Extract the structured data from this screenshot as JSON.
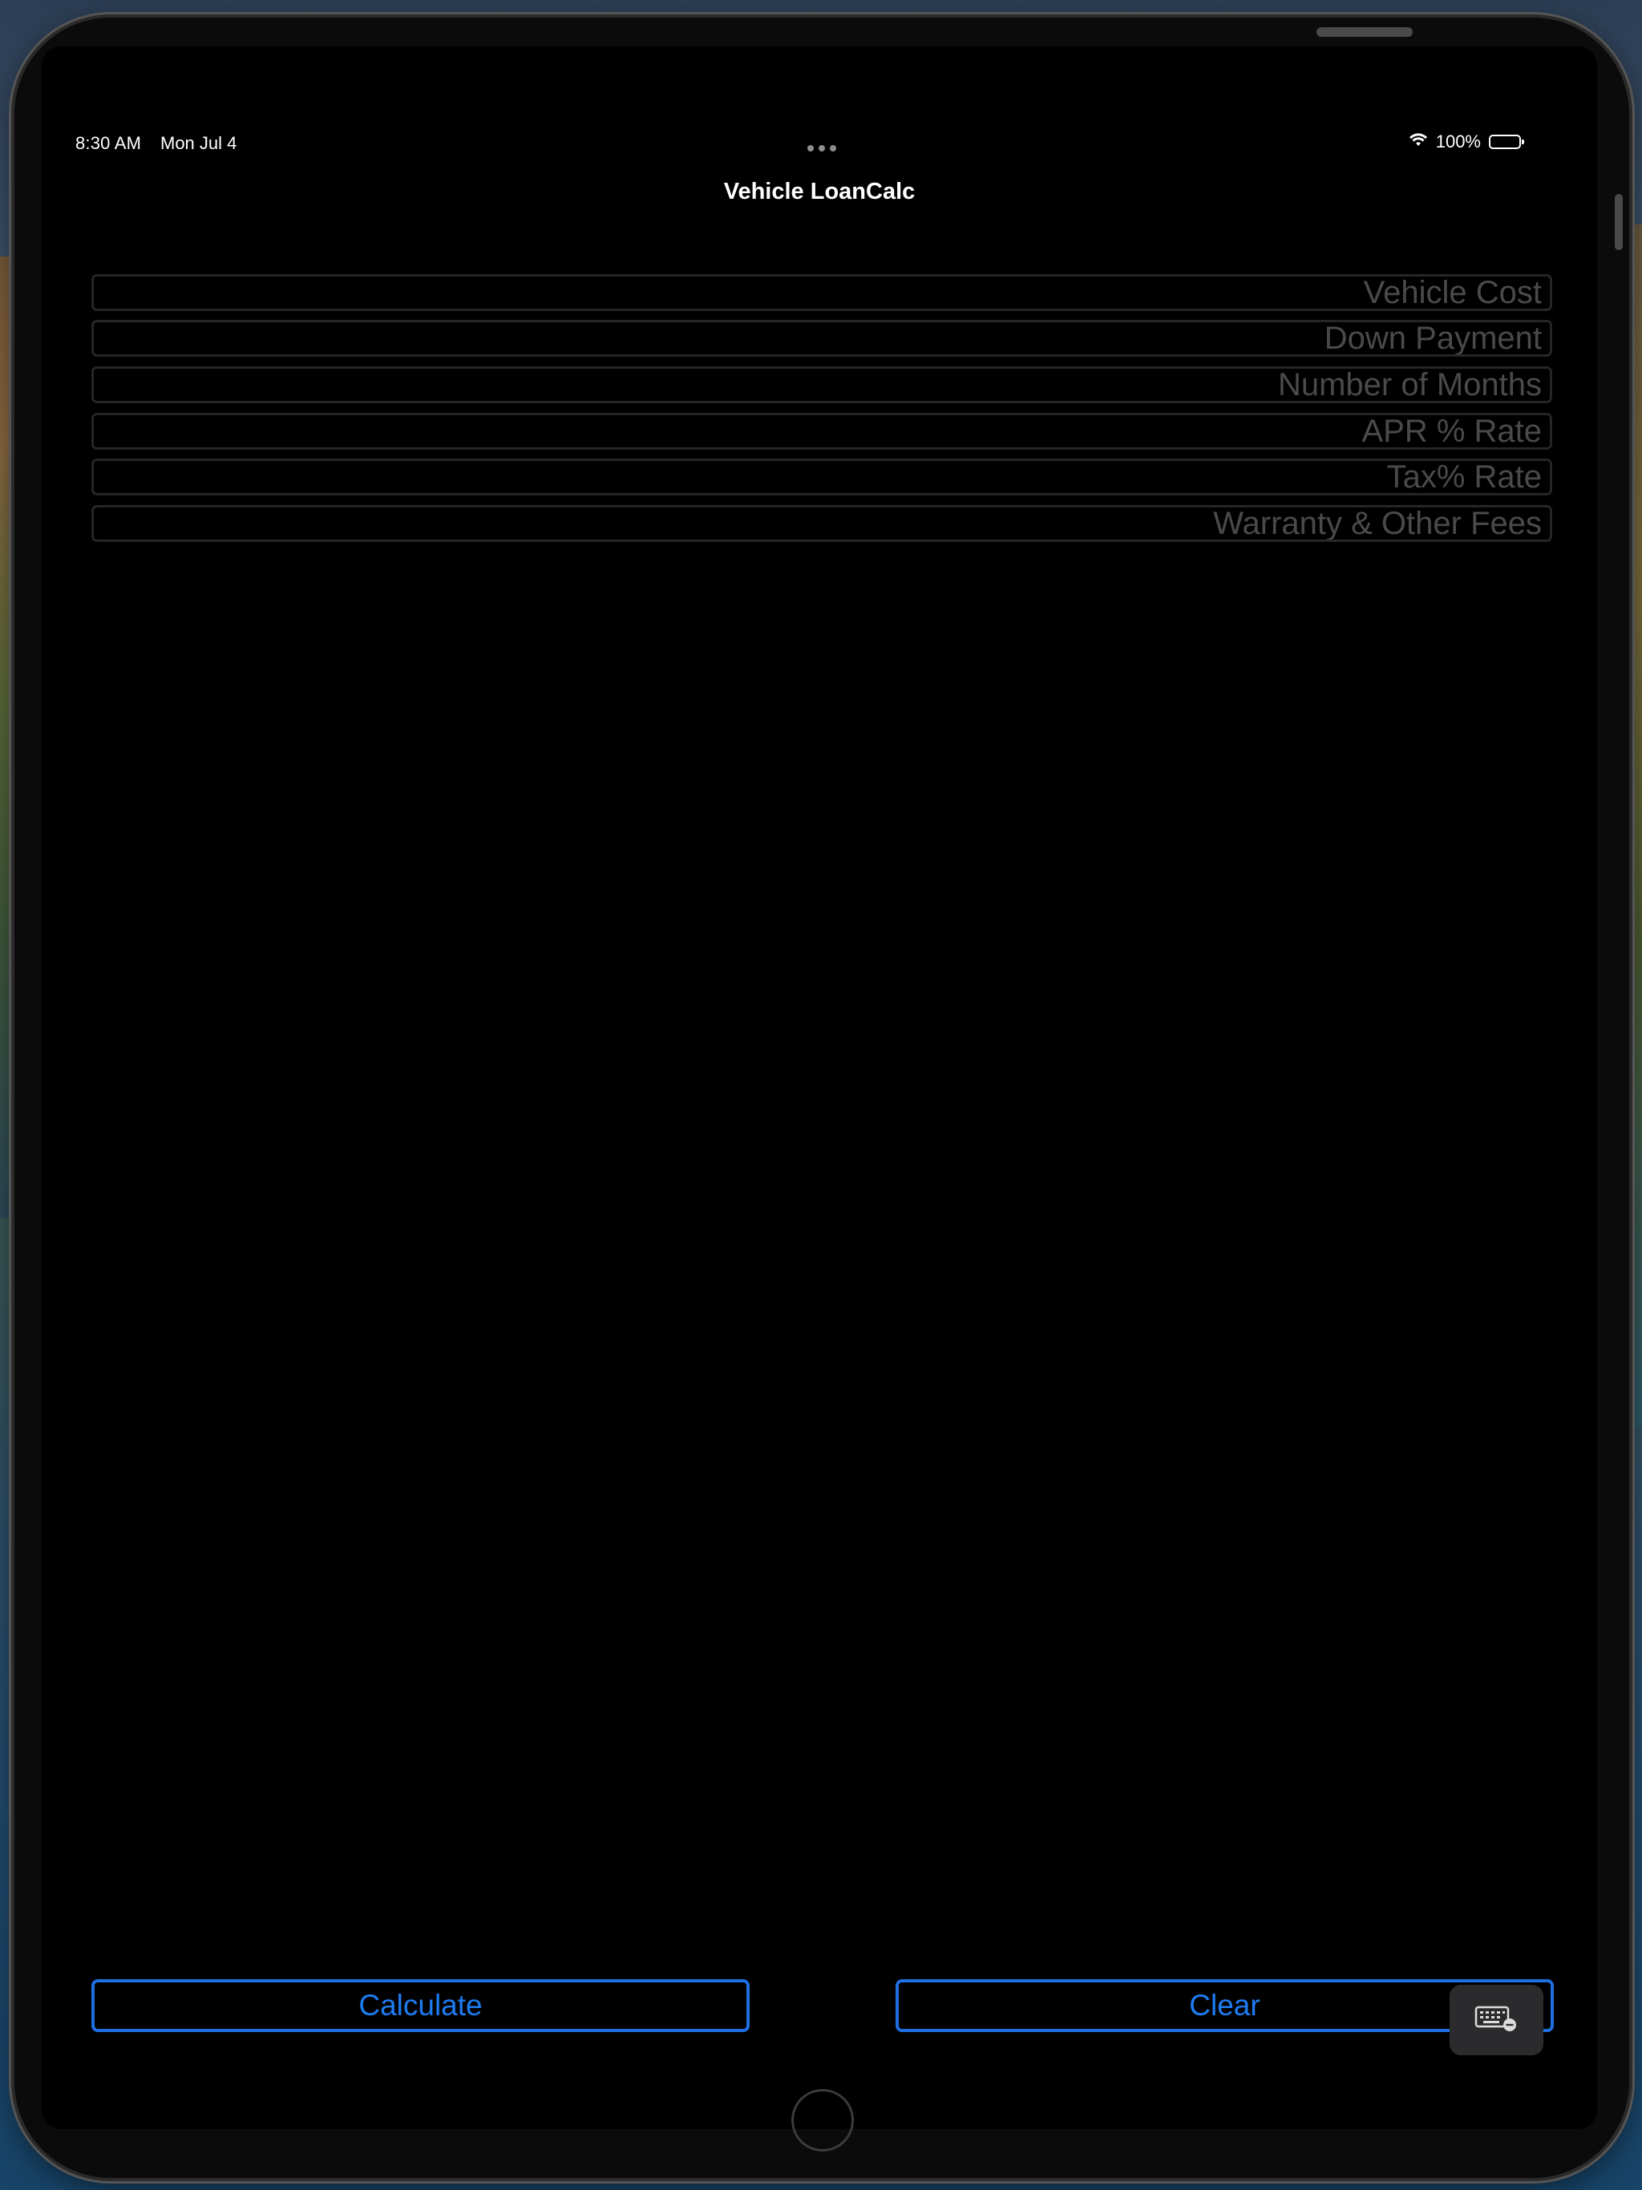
{
  "status_bar": {
    "time": "8:30 AM",
    "date": "Mon Jul 4",
    "battery_percent": "100%"
  },
  "nav": {
    "title": "Vehicle LoanCalc"
  },
  "form": {
    "fields": [
      {
        "placeholder": "Vehicle Cost",
        "value": ""
      },
      {
        "placeholder": "Down Payment",
        "value": ""
      },
      {
        "placeholder": "Number of Months",
        "value": ""
      },
      {
        "placeholder": "APR % Rate",
        "value": ""
      },
      {
        "placeholder": "Tax% Rate",
        "value": ""
      },
      {
        "placeholder": "Warranty & Other Fees",
        "value": ""
      }
    ]
  },
  "actions": {
    "calculate_label": "Calculate",
    "clear_label": "Clear"
  },
  "icons": {
    "keyboard": "keyboard-dismiss-icon",
    "wifi": "wifi-icon",
    "battery": "battery-icon"
  },
  "colors": {
    "accent": "#1e7cf2",
    "background": "#000000",
    "field_border": "#262626",
    "placeholder": "#4a4a4a"
  }
}
